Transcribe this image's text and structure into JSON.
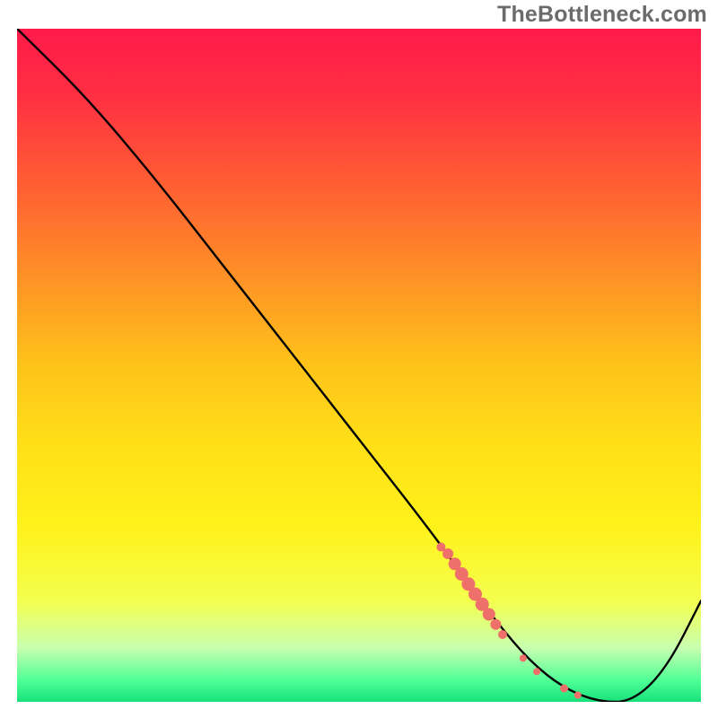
{
  "watermark": "TheBottleneck.com",
  "chart_data": {
    "type": "line",
    "title": "",
    "xlabel": "",
    "ylabel": "",
    "xlim": [
      0,
      100
    ],
    "ylim": [
      0,
      100
    ],
    "background_gradient": {
      "stops": [
        {
          "offset": 0.0,
          "color": "#ff1a4a"
        },
        {
          "offset": 0.1,
          "color": "#ff2f42"
        },
        {
          "offset": 0.22,
          "color": "#ff5a34"
        },
        {
          "offset": 0.35,
          "color": "#ff8a28"
        },
        {
          "offset": 0.5,
          "color": "#ffc31a"
        },
        {
          "offset": 0.62,
          "color": "#ffe018"
        },
        {
          "offset": 0.74,
          "color": "#fff21a"
        },
        {
          "offset": 0.85,
          "color": "#f4ff4e"
        },
        {
          "offset": 0.92,
          "color": "#c8ffb0"
        },
        {
          "offset": 0.97,
          "color": "#4bff95"
        },
        {
          "offset": 1.0,
          "color": "#18e07a"
        }
      ]
    },
    "series": [
      {
        "name": "curve",
        "x": [
          0,
          10,
          20,
          30,
          40,
          50,
          60,
          65,
          70,
          75,
          80,
          85,
          90,
          95,
          100
        ],
        "y": [
          100,
          90,
          78,
          65,
          52,
          39,
          26,
          19,
          12,
          6,
          2,
          0,
          0,
          5,
          15
        ]
      }
    ],
    "markers": {
      "name": "highlight",
      "color": "#ef6f6a",
      "points": [
        {
          "x": 62,
          "y": 23,
          "r": 5
        },
        {
          "x": 63,
          "y": 22,
          "r": 6
        },
        {
          "x": 64,
          "y": 20.5,
          "r": 7
        },
        {
          "x": 65,
          "y": 19,
          "r": 7.5
        },
        {
          "x": 66,
          "y": 17.5,
          "r": 7.5
        },
        {
          "x": 67,
          "y": 16,
          "r": 7.5
        },
        {
          "x": 68,
          "y": 14.5,
          "r": 7.5
        },
        {
          "x": 69,
          "y": 13,
          "r": 7
        },
        {
          "x": 70,
          "y": 11.5,
          "r": 6
        },
        {
          "x": 71,
          "y": 10,
          "r": 5
        },
        {
          "x": 74,
          "y": 6.5,
          "r": 4
        },
        {
          "x": 76,
          "y": 4.5,
          "r": 4
        },
        {
          "x": 80,
          "y": 2.0,
          "r": 4.5
        },
        {
          "x": 82,
          "y": 1.0,
          "r": 4
        }
      ]
    }
  }
}
